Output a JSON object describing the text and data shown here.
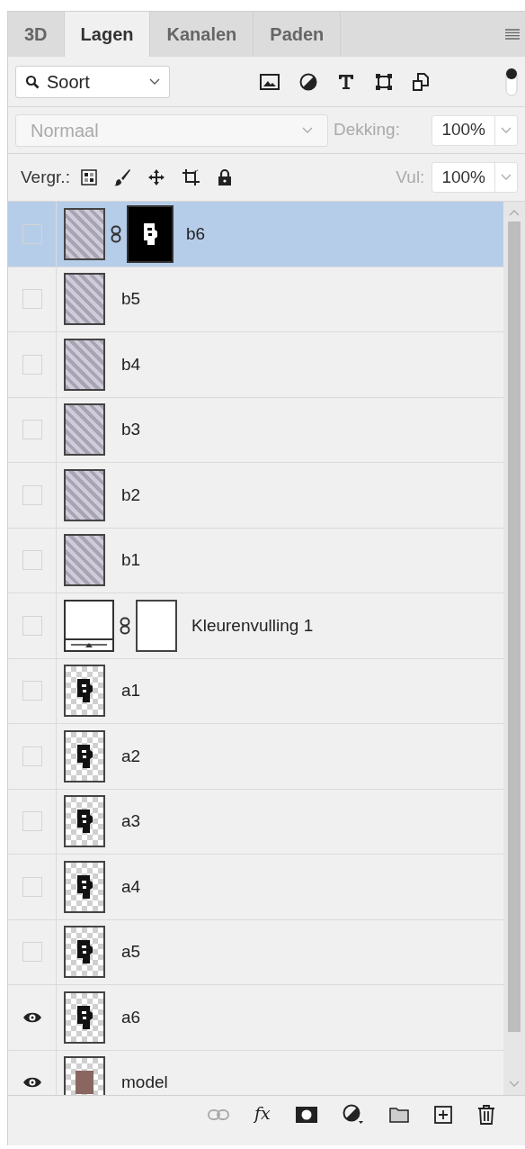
{
  "tabs": [
    {
      "label": "3D",
      "selected": false
    },
    {
      "label": "Lagen",
      "selected": true
    },
    {
      "label": "Kanalen",
      "selected": false
    },
    {
      "label": "Paden",
      "selected": false
    }
  ],
  "filter": {
    "value": "Soort"
  },
  "blend_mode": {
    "value": "Normaal",
    "disabled": true
  },
  "opacity": {
    "label": "Dekking:",
    "value": "100%"
  },
  "lock": {
    "label": "Vergr.:"
  },
  "fill": {
    "label": "Vul:",
    "value": "100%"
  },
  "layers": [
    {
      "name": "b6",
      "kind": "masked",
      "visible": false,
      "selected": true
    },
    {
      "name": "b5",
      "kind": "texture",
      "visible": false,
      "selected": false
    },
    {
      "name": "b4",
      "kind": "texture",
      "visible": false,
      "selected": false
    },
    {
      "name": "b3",
      "kind": "texture",
      "visible": false,
      "selected": false
    },
    {
      "name": "b2",
      "kind": "texture",
      "visible": false,
      "selected": false
    },
    {
      "name": "b1",
      "kind": "texture",
      "visible": false,
      "selected": false
    },
    {
      "name": "Kleurenvulling 1",
      "kind": "fill",
      "visible": false,
      "selected": false
    },
    {
      "name": "a1",
      "kind": "figure",
      "visible": false,
      "selected": false
    },
    {
      "name": "a2",
      "kind": "figure",
      "visible": false,
      "selected": false
    },
    {
      "name": "a3",
      "kind": "figure",
      "visible": false,
      "selected": false
    },
    {
      "name": "a4",
      "kind": "figure",
      "visible": false,
      "selected": false
    },
    {
      "name": "a5",
      "kind": "figure",
      "visible": false,
      "selected": false
    },
    {
      "name": "a6",
      "kind": "figure",
      "visible": true,
      "selected": false
    },
    {
      "name": "model",
      "kind": "photo",
      "visible": true,
      "selected": false
    }
  ],
  "footer": {
    "effects_button": "fx"
  }
}
